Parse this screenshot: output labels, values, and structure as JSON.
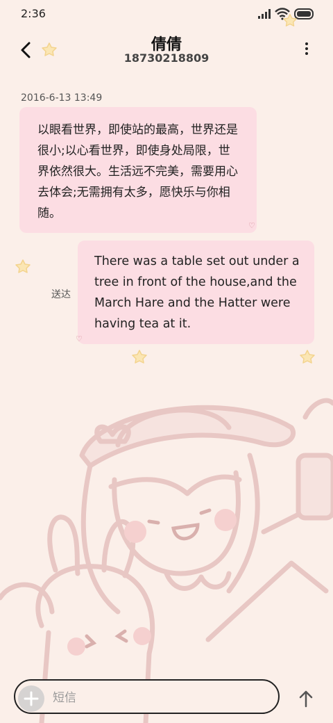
{
  "status_bar": {
    "time": "2:36"
  },
  "header": {
    "title": "倩倩",
    "subtitle": "18730218809"
  },
  "conversation": {
    "timestamp": "2016-6-13 13:49",
    "incoming_message": "以眼看世界，即使站的最高，世界还是很小;以心看世界，即使身处局限，世界依然很大。生活远不完美，需要用心去体会;无需拥有太多，愿快乐与你相随。",
    "outgoing_message": "There was a table set out under a tree in front of the house,and the March Hare and the Hatter were having tea at it.",
    "outgoing_status": "送达"
  },
  "composer": {
    "placeholder": "短信"
  },
  "icons": {
    "back": "back-arrow-icon",
    "more": "more-vertical-icon",
    "add": "plus-icon",
    "send": "arrow-up-icon"
  },
  "colors": {
    "background": "#fbefe9",
    "bubble": "#fcdde3",
    "art_line": "#e6c3c1"
  }
}
